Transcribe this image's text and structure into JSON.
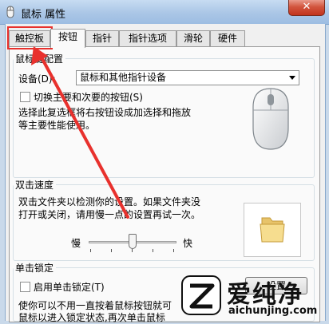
{
  "window": {
    "title": "鼠标 属性",
    "close_label": "✕"
  },
  "tabs": [
    "触控板",
    "按钮",
    "指针",
    "指针选项",
    "滑轮",
    "硬件"
  ],
  "button_config": {
    "group_label": "鼠标键配置",
    "device_label": "设备(D):",
    "device_value": "鼠标和其他指针设备",
    "switch_label": "切换主要和次要的按钮(S)",
    "desc_line1": "选择此复选框将右按钮设成加选择和拖放",
    "desc_line2": "等主要性能使用。"
  },
  "double_click": {
    "group_label": "双击速度",
    "desc_line1": "双击文件夹以检测你的设置。如果文件夹没",
    "desc_line2": "打开或关闭，请用慢一点的设置再试一次。",
    "slow_label": "慢",
    "fast_label": "快",
    "speed_fraction": 0.5
  },
  "click_lock": {
    "group_label": "单击锁定",
    "enable_label": "启用单击锁定(T)",
    "settings_label": "设置",
    "desc_line1": "使你可以不用一直按着鼠标按钮就可",
    "desc_line2": "鼠标以进入锁定状态,再次单击鼠标"
  },
  "watermark": {
    "brand": "爱纯净",
    "url": "aichunjing.com"
  },
  "colors": {
    "annotation_red": "#e8312d",
    "titlebar_blue": "#aac6e6"
  }
}
